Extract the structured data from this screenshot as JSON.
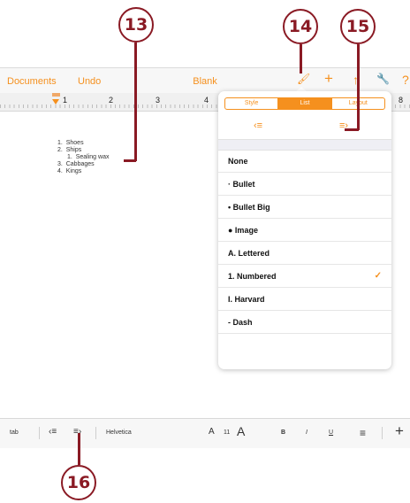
{
  "callouts": [
    "13",
    "14",
    "15",
    "16"
  ],
  "navbar": {
    "documents": "Documents",
    "undo": "Undo",
    "title": "Blank",
    "brush_icon": "🖌",
    "add_icon": "+",
    "share_icon": "↑",
    "wrench_icon": "🔧",
    "help_icon": "?"
  },
  "ruler": {
    "numbers": [
      "1",
      "2",
      "3",
      "4",
      "8"
    ]
  },
  "document": {
    "lines": [
      "1.  Shoes",
      "2.  Ships",
      "1.  Sealing wax",
      "3.  Cabbages",
      "4.  Kings"
    ]
  },
  "popover": {
    "tabs": [
      "Style",
      "List",
      "Layout"
    ],
    "active_tab": "List",
    "outdent_icon": "‹≡",
    "indent_icon": "≡›",
    "options": [
      {
        "label": "None",
        "checked": false
      },
      {
        "label": "·  Bullet",
        "checked": false
      },
      {
        "label": "•  Bullet Big",
        "checked": false
      },
      {
        "label": "● Image",
        "checked": false
      },
      {
        "label": "A.  Lettered",
        "checked": false
      },
      {
        "label": "1.  Numbered",
        "checked": true
      },
      {
        "label": "I.   Harvard",
        "checked": false
      },
      {
        "label": "-  Dash",
        "checked": false
      }
    ],
    "check_icon": "✓"
  },
  "toolbar": {
    "tab": "tab",
    "outdent": "‹≡",
    "indent": "≡›",
    "font": "Helvetica",
    "size_small_a": "A",
    "size": "11",
    "size_large_a": "A",
    "bold": "B",
    "italic": "I",
    "underline": "U",
    "align": "≡",
    "add": "+"
  },
  "colors": {
    "accent": "#f5901e",
    "callout": "#8a1a24"
  }
}
